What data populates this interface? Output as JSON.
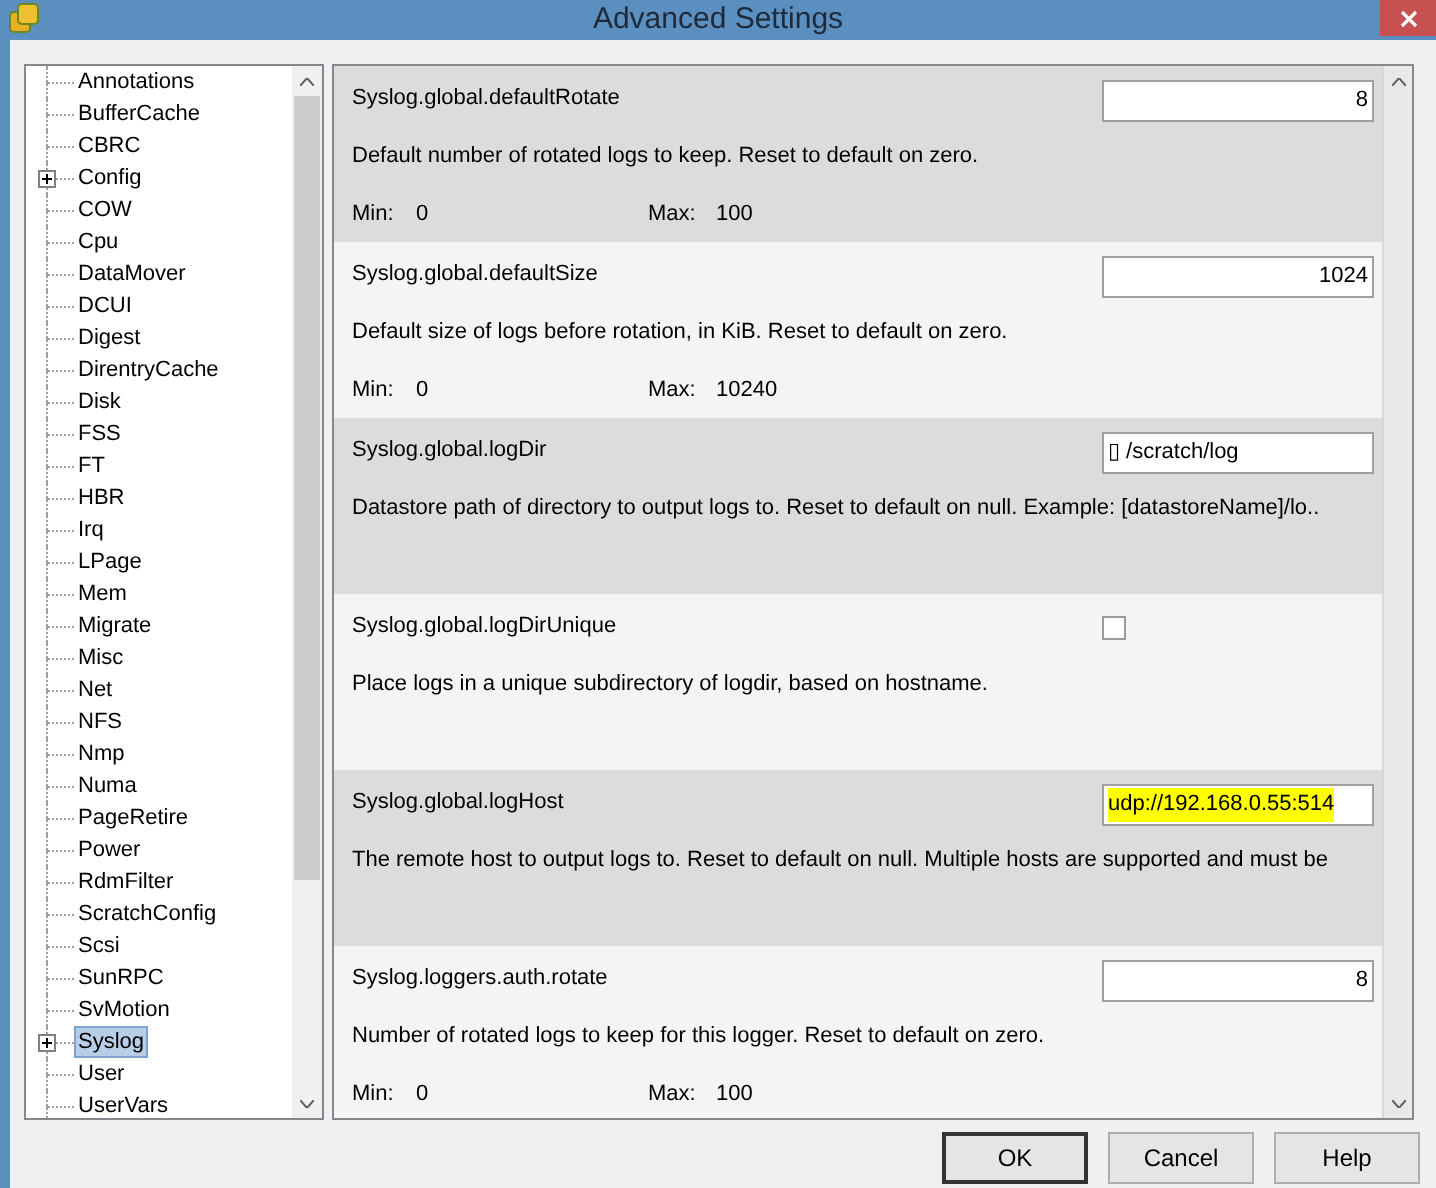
{
  "window": {
    "title": "Advanced Settings"
  },
  "tree": [
    {
      "label": "Annotations",
      "expandable": false,
      "selected": false
    },
    {
      "label": "BufferCache",
      "expandable": false,
      "selected": false
    },
    {
      "label": "CBRC",
      "expandable": false,
      "selected": false
    },
    {
      "label": "Config",
      "expandable": true,
      "selected": false
    },
    {
      "label": "COW",
      "expandable": false,
      "selected": false
    },
    {
      "label": "Cpu",
      "expandable": false,
      "selected": false
    },
    {
      "label": "DataMover",
      "expandable": false,
      "selected": false
    },
    {
      "label": "DCUI",
      "expandable": false,
      "selected": false
    },
    {
      "label": "Digest",
      "expandable": false,
      "selected": false
    },
    {
      "label": "DirentryCache",
      "expandable": false,
      "selected": false
    },
    {
      "label": "Disk",
      "expandable": false,
      "selected": false
    },
    {
      "label": "FSS",
      "expandable": false,
      "selected": false
    },
    {
      "label": "FT",
      "expandable": false,
      "selected": false
    },
    {
      "label": "HBR",
      "expandable": false,
      "selected": false
    },
    {
      "label": "Irq",
      "expandable": false,
      "selected": false
    },
    {
      "label": "LPage",
      "expandable": false,
      "selected": false
    },
    {
      "label": "Mem",
      "expandable": false,
      "selected": false
    },
    {
      "label": "Migrate",
      "expandable": false,
      "selected": false
    },
    {
      "label": "Misc",
      "expandable": false,
      "selected": false
    },
    {
      "label": "Net",
      "expandable": false,
      "selected": false
    },
    {
      "label": "NFS",
      "expandable": false,
      "selected": false
    },
    {
      "label": "Nmp",
      "expandable": false,
      "selected": false
    },
    {
      "label": "Numa",
      "expandable": false,
      "selected": false
    },
    {
      "label": "PageRetire",
      "expandable": false,
      "selected": false
    },
    {
      "label": "Power",
      "expandable": false,
      "selected": false
    },
    {
      "label": "RdmFilter",
      "expandable": false,
      "selected": false
    },
    {
      "label": "ScratchConfig",
      "expandable": false,
      "selected": false
    },
    {
      "label": "Scsi",
      "expandable": false,
      "selected": false
    },
    {
      "label": "SunRPC",
      "expandable": false,
      "selected": false
    },
    {
      "label": "SvMotion",
      "expandable": false,
      "selected": false
    },
    {
      "label": "Syslog",
      "expandable": true,
      "selected": true
    },
    {
      "label": "User",
      "expandable": false,
      "selected": false
    },
    {
      "label": "UserVars",
      "expandable": false,
      "selected": false
    }
  ],
  "settings": [
    {
      "name": "Syslog.global.defaultRotate",
      "kind": "number",
      "value": "8",
      "highlighted": false,
      "description": "Default number of rotated logs to keep. Reset to default on zero.",
      "min_label": "Min:",
      "min": "0",
      "max_label": "Max:",
      "max": "100"
    },
    {
      "name": "Syslog.global.defaultSize",
      "kind": "number",
      "value": "1024",
      "highlighted": false,
      "description": "Default size of logs before rotation, in KiB. Reset to default on zero.",
      "min_label": "Min:",
      "min": "0",
      "max_label": "Max:",
      "max": "10240"
    },
    {
      "name": "Syslog.global.logDir",
      "kind": "text",
      "value": "▯ /scratch/log",
      "highlighted": false,
      "description": "Datastore path of directory to output logs to. Reset to default on null. Example: [datastoreName]/lo.."
    },
    {
      "name": "Syslog.global.logDirUnique",
      "kind": "checkbox",
      "checked": false,
      "description": "Place logs in a unique subdirectory of logdir, based on hostname."
    },
    {
      "name": "Syslog.global.logHost",
      "kind": "text",
      "value": "udp://192.168.0.55:514",
      "highlighted": true,
      "description": "The remote host to output logs to. Reset to default on null. Multiple hosts are supported and must be"
    },
    {
      "name": "Syslog.loggers.auth.rotate",
      "kind": "number",
      "value": "8",
      "highlighted": false,
      "description": "Number of rotated logs to keep for this logger. Reset to default on zero.",
      "min_label": "Min:",
      "min": "0",
      "max_label": "Max:",
      "max": "100"
    }
  ],
  "buttons": [
    {
      "label": "OK",
      "default": true
    },
    {
      "label": "Cancel",
      "default": false
    },
    {
      "label": "Help",
      "default": false
    }
  ]
}
